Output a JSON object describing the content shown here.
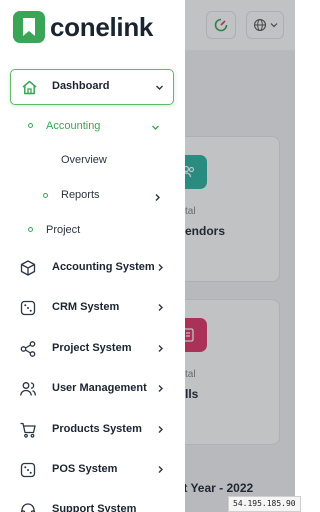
{
  "sidebar": {
    "logo_text": "conelink",
    "dashboard_label": "Dashboard",
    "accounting_label": "Accounting",
    "overview_label": "Overview",
    "reports_label": "Reports",
    "project_label": "Project",
    "menu": [
      {
        "label": "Accounting System",
        "icon": "cube-icon"
      },
      {
        "label": "CRM System",
        "icon": "dice-icon"
      },
      {
        "label": "Project System",
        "icon": "share-icon"
      },
      {
        "label": "User Management",
        "icon": "users-icon"
      },
      {
        "label": "Products System",
        "icon": "cart-icon"
      },
      {
        "label": "POS System",
        "icon": "dice-icon"
      },
      {
        "label": "Support System",
        "icon": "headset-icon"
      }
    ]
  },
  "background": {
    "card1_small": "tal",
    "card1_big": "endors",
    "card2_small": "tal",
    "card2_big": "lls",
    "year_title": "nt Year - 2022"
  },
  "ip_address": "54.195.185.90",
  "colors": {
    "brand_green": "#3aa557",
    "teal": "#2fb5a3",
    "pink": "#e0386a"
  }
}
